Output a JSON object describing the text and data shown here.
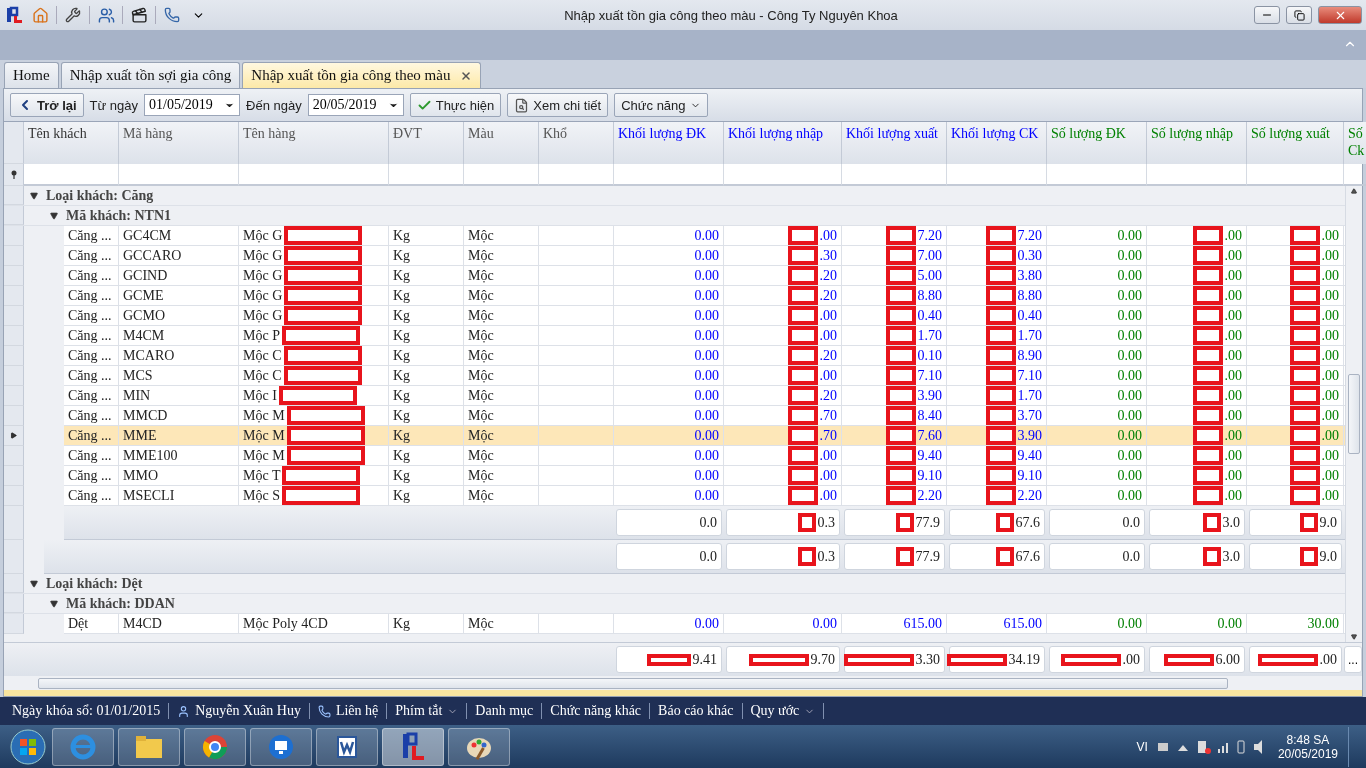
{
  "window": {
    "title": "Nhập xuất tồn gia công theo màu - Công Ty Nguyên Khoa"
  },
  "tabs": [
    {
      "label": "Home",
      "selected": false,
      "closable": false
    },
    {
      "label": "Nhập xuất tồn sợi gia công",
      "selected": false,
      "closable": false
    },
    {
      "label": "Nhập xuất tồn gia công theo màu",
      "selected": true,
      "closable": true
    }
  ],
  "toolbar": {
    "back": "Trở lại",
    "from_label": "Từ ngày",
    "from_value": "01/05/2019",
    "to_label": "Đến ngày",
    "to_value": "20/05/2019",
    "run": "Thực hiện",
    "details": "Xem chi tiết",
    "functions": "Chức năng"
  },
  "grid": {
    "columns": [
      {
        "label": "Tên khách",
        "color": "#333333",
        "redacted": false
      },
      {
        "label": "Mã hàng",
        "color": "#555555",
        "redacted": false
      },
      {
        "label": "Tên hàng",
        "color": "#555555",
        "redacted": true
      },
      {
        "label": "ĐVT",
        "color": "#555555",
        "redacted": false
      },
      {
        "label": "Màu",
        "color": "#555555",
        "redacted": false
      },
      {
        "label": "Khổ",
        "color": "#555555",
        "redacted": false
      },
      {
        "label": "Khối lượng ĐK",
        "color": "#0000ff",
        "redacted": false
      },
      {
        "label": "Khối lượng nhập",
        "color": "#0000ff",
        "redacted": true
      },
      {
        "label": "Khối lượng xuất",
        "color": "#0000ff",
        "redacted": true
      },
      {
        "label": "Khối lượng CK",
        "color": "#0000ff",
        "redacted": true
      },
      {
        "label": "Số lượng ĐK",
        "color": "#008000",
        "redacted": false
      },
      {
        "label": "Số lượng nhập",
        "color": "#008000",
        "redacted": true
      },
      {
        "label": "Số lượng xuất",
        "color": "#008000",
        "redacted": true
      },
      {
        "label": "Số Ck",
        "color": "#008000",
        "redacted": false
      }
    ],
    "groups": [
      {
        "label": "Loại khách: Căng",
        "expanded": true,
        "children": [
          {
            "label": "Mã khách: NTN1",
            "expanded": true,
            "rows": [
              {
                "selected": false,
                "cells": [
                  "Căng ...",
                  "GC4CM",
                  "Mộc G",
                  "Kg",
                  "Mộc"
                ],
                "values": [
                  "0.00",
                  ".00",
                  "7.20",
                  "7.20",
                  "0.00",
                  ".00",
                  ".00"
                ]
              },
              {
                "selected": false,
                "cells": [
                  "Căng ...",
                  "GCCARO",
                  "Mộc G",
                  "Kg",
                  "Mộc"
                ],
                "values": [
                  "0.00",
                  ".30",
                  "7.00",
                  "0.30",
                  "0.00",
                  ".00",
                  ".00"
                ]
              },
              {
                "selected": false,
                "cells": [
                  "Căng ...",
                  "GCIND",
                  "Mộc G",
                  "Kg",
                  "Mộc"
                ],
                "values": [
                  "0.00",
                  ".20",
                  "5.00",
                  "3.80",
                  "0.00",
                  ".00",
                  ".00"
                ]
              },
              {
                "selected": false,
                "cells": [
                  "Căng ...",
                  "GCME",
                  "Mộc G",
                  "Kg",
                  "Mộc"
                ],
                "values": [
                  "0.00",
                  ".20",
                  "8.80",
                  "8.80",
                  "0.00",
                  ".00",
                  ".00"
                ]
              },
              {
                "selected": false,
                "cells": [
                  "Căng ...",
                  "GCMO",
                  "Mộc G",
                  "Kg",
                  "Mộc"
                ],
                "values": [
                  "0.00",
                  ".00",
                  "0.40",
                  "0.40",
                  "0.00",
                  ".00",
                  ".00"
                ]
              },
              {
                "selected": false,
                "cells": [
                  "Căng ...",
                  "M4CM",
                  "Mộc P",
                  "Kg",
                  "Mộc"
                ],
                "values": [
                  "0.00",
                  ".00",
                  "1.70",
                  "1.70",
                  "0.00",
                  ".00",
                  ".00"
                ]
              },
              {
                "selected": false,
                "cells": [
                  "Căng ...",
                  "MCARO",
                  "Mộc C",
                  "Kg",
                  "Mộc"
                ],
                "values": [
                  "0.00",
                  ".20",
                  "0.10",
                  "8.90",
                  "0.00",
                  ".00",
                  ".00"
                ]
              },
              {
                "selected": false,
                "cells": [
                  "Căng ...",
                  "MCS",
                  "Mộc C",
                  "Kg",
                  "Mộc"
                ],
                "values": [
                  "0.00",
                  ".00",
                  "7.10",
                  "7.10",
                  "0.00",
                  ".00",
                  ".00"
                ]
              },
              {
                "selected": false,
                "cells": [
                  "Căng ...",
                  "MIN",
                  "Mộc I",
                  "Kg",
                  "Mộc"
                ],
                "values": [
                  "0.00",
                  ".20",
                  "3.90",
                  "1.70",
                  "0.00",
                  ".00",
                  ".00"
                ]
              },
              {
                "selected": false,
                "cells": [
                  "Căng ...",
                  "MMCD",
                  "Mộc M",
                  "Kg",
                  "Mộc"
                ],
                "values": [
                  "0.00",
                  ".70",
                  "8.40",
                  "3.70",
                  "0.00",
                  ".00",
                  ".00"
                ]
              },
              {
                "selected": true,
                "cells": [
                  "Căng ...",
                  "MME",
                  "Mộc M",
                  "Kg",
                  "Mộc"
                ],
                "values": [
                  "0.00",
                  ".70",
                  "7.60",
                  "3.90",
                  "0.00",
                  ".00",
                  ".00"
                ]
              },
              {
                "selected": false,
                "cells": [
                  "Căng ...",
                  "MME100",
                  "Mộc M",
                  "Kg",
                  "Mộc"
                ],
                "values": [
                  "0.00",
                  ".00",
                  "9.40",
                  "9.40",
                  "0.00",
                  ".00",
                  ".00"
                ]
              },
              {
                "selected": false,
                "cells": [
                  "Căng ...",
                  "MMO",
                  "Mộc T",
                  "Kg",
                  "Mộc"
                ],
                "values": [
                  "0.00",
                  ".00",
                  "9.10",
                  "9.10",
                  "0.00",
                  ".00",
                  ".00"
                ]
              },
              {
                "selected": false,
                "cells": [
                  "Căng ...",
                  "MSECLI",
                  "Mộc S",
                  "Kg",
                  "Mộc"
                ],
                "values": [
                  "0.00",
                  ".00",
                  "2.20",
                  "2.20",
                  "0.00",
                  ".00",
                  ".00"
                ]
              }
            ],
            "summary": [
              "0.0",
              "0.3",
              "77.9",
              "67.6",
              "0.0",
              "3.0",
              "9.0"
            ]
          }
        ],
        "summary": [
          "0.0",
          "0.3",
          "77.9",
          "67.6",
          "0.0",
          "3.0",
          "9.0"
        ]
      },
      {
        "label": "Loại khách: Dệt",
        "expanded": true,
        "children": [
          {
            "label": "Mã khách: DDAN",
            "expanded": true,
            "rows": [
              {
                "selected": false,
                "redacted": false,
                "cells": [
                  "Dệt",
                  "M4CD",
                  "Mộc Poly 4CD",
                  "Kg",
                  "Mộc"
                ],
                "values": [
                  "0.00",
                  "0.00",
                  "615.00",
                  "615.00",
                  "0.00",
                  "0.00",
                  "30.00"
                ]
              }
            ]
          }
        ]
      }
    ],
    "totals": {
      "redacted": true,
      "values": [
        "9.41",
        "9.70",
        "3.30",
        "34.19",
        ".00",
        "6.00",
        ".00"
      ],
      "more": "..."
    }
  },
  "status_bar": [
    {
      "kind": "text",
      "label": "Ngày khóa sổ: 01/01/2015"
    },
    {
      "kind": "user",
      "label": "Nguyễn Xuân Huy"
    },
    {
      "kind": "contact",
      "label": "Liên hệ"
    },
    {
      "kind": "menu",
      "label": "Phím tắt"
    },
    {
      "kind": "text",
      "label": "Danh mục"
    },
    {
      "kind": "text",
      "label": "Chức năng khác"
    },
    {
      "kind": "text",
      "label": "Báo cáo khác"
    },
    {
      "kind": "menu",
      "label": "Quy ước"
    }
  ],
  "tray": {
    "language": "VI",
    "time": "8:48 SA",
    "date": "20/05/2019"
  }
}
